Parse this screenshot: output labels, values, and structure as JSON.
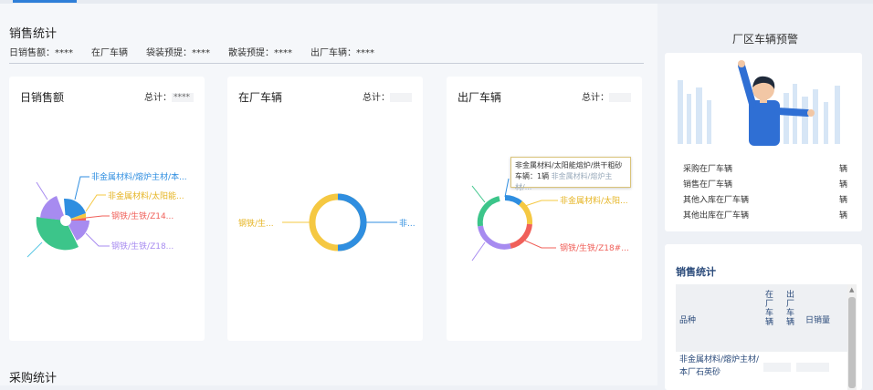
{
  "sales": {
    "title": "销售统计",
    "daily_sales_label": "日销售额：",
    "daily_sales_value": "****",
    "in_factory_label": "在厂车辆",
    "bag_warning_label": "袋装预提：",
    "bag_warning_value": "****",
    "bulk_warning_label": "散装预提：",
    "bulk_warning_value": "****",
    "out_factory_label": "出厂车辆：",
    "out_factory_value": "****"
  },
  "cards": [
    {
      "title": "日销售额",
      "total_label": "总计：",
      "total_value": "****"
    },
    {
      "title": "在厂车辆",
      "total_label": "总计：",
      "total_value": ""
    },
    {
      "title": "出厂车辆",
      "total_label": "总计：",
      "total_value": ""
    }
  ],
  "card1_labels": [
    "非金属材料/熔炉主材/本...",
    "非金属材料/太阳能...",
    "钢铁/生铁/Z14...",
    "钢铁/生铁/Z18..."
  ],
  "card2_labels": [
    "钢铁/生...",
    "非..."
  ],
  "card3_labels": [
    "非金属材料/太阳...",
    "钢铁/生铁/Z18#..."
  ],
  "tooltip": {
    "line1": "非金属材料/太阳能熔炉/烘干粗砂",
    "line2": "车辆：1辆",
    "ghost": "非金属材料/熔炉主材/..."
  },
  "purchase": {
    "title": "采购统计"
  },
  "side": {
    "alarm_title": "厂区车辆预警",
    "alarm_rows": [
      {
        "label": "采购在厂车辆",
        "unit": "辆"
      },
      {
        "label": "销售在厂车辆",
        "unit": "辆"
      },
      {
        "label": "其他入库在厂车辆",
        "unit": "辆"
      },
      {
        "label": "其他出库在厂车辆",
        "unit": "辆"
      }
    ],
    "stats_title": "销售统计",
    "table_headers": {
      "product": "品种",
      "in_factory": "在厂车辆",
      "out_factory": "出厂车辆",
      "daily_sales": "日销量"
    },
    "table_rows": [
      {
        "product": "非金属材料/熔炉主材/本厂石英砂"
      }
    ]
  },
  "colors": {
    "blue": "#2f8ee0",
    "yellow": "#f5c842",
    "red": "#f0605a",
    "purple": "#a78bf0",
    "green": "#3cc58a",
    "cyan": "#57c7e3",
    "accent": "#2f7fd8"
  }
}
